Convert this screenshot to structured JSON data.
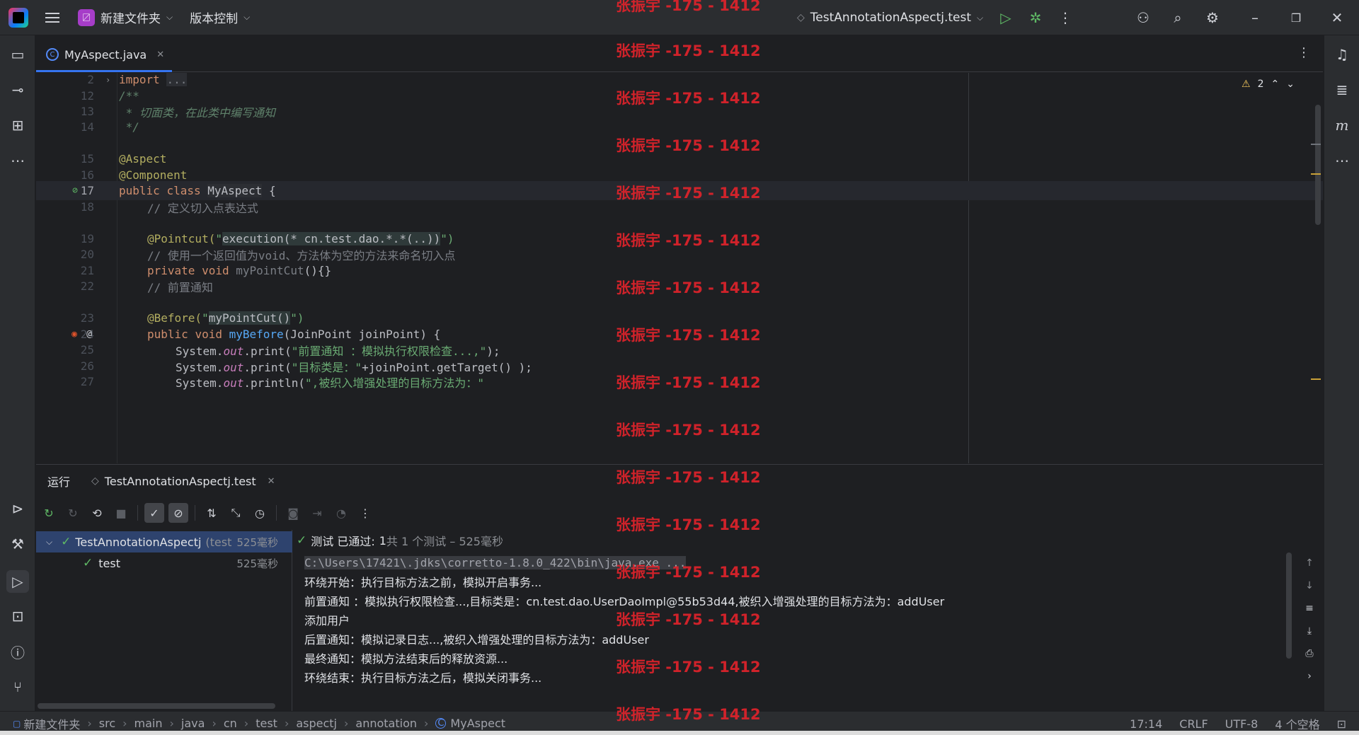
{
  "titlebar": {
    "project_badge": "〼",
    "project_name": "新建文件夹",
    "vcs_label": "版本控制",
    "run_config": "TestAnnotationAspectj.test"
  },
  "watermark": "张振宇 -175 - 1412",
  "editor": {
    "tab_label": "MyAspect.java",
    "warnings": "2",
    "lines": [
      {
        "n": "2",
        "t": "import_fold"
      },
      {
        "n": "12",
        "t": "doc_open"
      },
      {
        "n": "13",
        "t": "doc_body"
      },
      {
        "n": "14",
        "t": "doc_close"
      },
      {
        "n": "15",
        "t": "aspect"
      },
      {
        "n": "16",
        "t": "component"
      },
      {
        "n": "17",
        "t": "class_decl"
      },
      {
        "n": "18",
        "t": "comment1"
      },
      {
        "n": "19",
        "t": "pointcut"
      },
      {
        "n": "20",
        "t": "comment2"
      },
      {
        "n": "21",
        "t": "method_ptc"
      },
      {
        "n": "22",
        "t": "comment3"
      },
      {
        "n": "23",
        "t": "before"
      },
      {
        "n": "24",
        "t": "method_before"
      },
      {
        "n": "25",
        "t": "print1"
      },
      {
        "n": "26",
        "t": "print2"
      },
      {
        "n": "27",
        "t": "print3"
      }
    ],
    "code": {
      "import_kw": "import",
      "import_fold": "...",
      "doc_open": "/**",
      "doc_body": " * 切面类，在此类中编写通知",
      "doc_close": " */",
      "aspect": "@Aspect",
      "component": "@Component",
      "public": "public",
      "class": "class",
      "classname": "MyAspect",
      "brace": " {",
      "comment1": "// 定义切入点表达式",
      "pointcut_ann": "@Pointcut(",
      "pointcut_q1": "\"",
      "pointcut_expr": "execution(* cn.test.dao.*.*(..))",
      "pointcut_q2": "\")",
      "comment2": "// 使用一个返回值为void、方法体为空的方法来命名切入点",
      "private": "private",
      "void": "void",
      "ptc_name": "myPointCut",
      "ptc_body": "(){}",
      "comment3": "// 前置通知",
      "before_ann": "@Before(",
      "before_q1": "\"",
      "before_ref": "myPointCut()",
      "before_q2": "\")",
      "mb_name": "myBefore",
      "mb_params": "(JoinPoint joinPoint) {",
      "sys": "System.",
      "out": "out",
      "print": ".print(",
      "println": ".println(",
      "p1_str": "\"前置通知 ：模拟执行权限检查...,\"",
      "p1_end": ");",
      "p2_str": "\"目标类是：\"",
      "p2_rest": "+joinPoint.getTarget() );",
      "p3_str": "\",被织入增强处理的目标方法为：\""
    }
  },
  "run_panel": {
    "title": "运行",
    "tab_label": "TestAnnotationAspectj.test",
    "tree": [
      {
        "label": "TestAnnotationAspectj",
        "suffix": "(test",
        "duration": "525毫秒"
      },
      {
        "label": "test",
        "duration": "525毫秒"
      }
    ],
    "status_pass": "测试 已通过:",
    "status_count": "1",
    "status_rest": "共 1 个测试 – 525毫秒",
    "console": [
      "C:\\Users\\17421\\.jdks\\corretto-1.8.0_422\\bin\\java.exe ...",
      "环绕开始：执行目标方法之前，模拟开启事务...",
      "前置通知 ：模拟执行权限检查...,目标类是：cn.test.dao.UserDaoImpl@55b53d44,被织入增强处理的目标方法为：addUser",
      "添加用户",
      "后置通知：模拟记录日志...,被织入增强处理的目标方法为：addUser",
      "最终通知：模拟方法结束后的释放资源...",
      "环绕结束：执行目标方法之后，模拟关闭事务..."
    ]
  },
  "statusbar": {
    "breadcrumbs": [
      "新建文件夹",
      "src",
      "main",
      "java",
      "cn",
      "test",
      "aspectj",
      "annotation",
      "MyAspect"
    ],
    "position": "17:14",
    "line_sep": "CRLF",
    "encoding": "UTF-8",
    "indent": "4 个空格"
  },
  "colors": {
    "accent": "#3574f0",
    "pass": "#5fb865",
    "watermark": "#e0232b"
  }
}
